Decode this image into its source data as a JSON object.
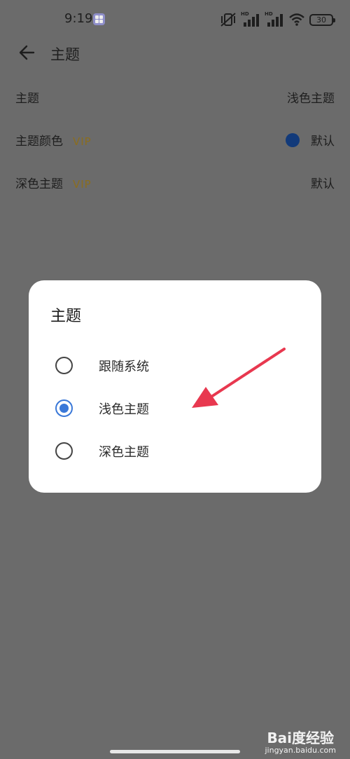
{
  "status_bar": {
    "time": "9:19",
    "battery": "30",
    "signal_1_label": "HD",
    "signal_2_label": "HD"
  },
  "header": {
    "title": "主题"
  },
  "settings": [
    {
      "label": "主题",
      "vip": "",
      "value": "浅色主题"
    },
    {
      "label": "主题颜色",
      "vip": "VIP",
      "value": "默认",
      "color": "#123a7a"
    },
    {
      "label": "深色主题",
      "vip": "VIP",
      "value": "默认"
    }
  ],
  "dialog": {
    "title": "主题",
    "options": [
      {
        "label": "跟随系统",
        "selected": false
      },
      {
        "label": "浅色主题",
        "selected": true
      },
      {
        "label": "深色主题",
        "selected": false
      }
    ]
  },
  "annotation": {
    "arrow_color": "#e8384f"
  },
  "watermark": {
    "brand": "Bai度经验",
    "url": "jingyan.baidu.com"
  },
  "colors": {
    "accent": "#3a78d8",
    "vip": "#8a6d1f",
    "overlay": "#6b6b6b"
  }
}
